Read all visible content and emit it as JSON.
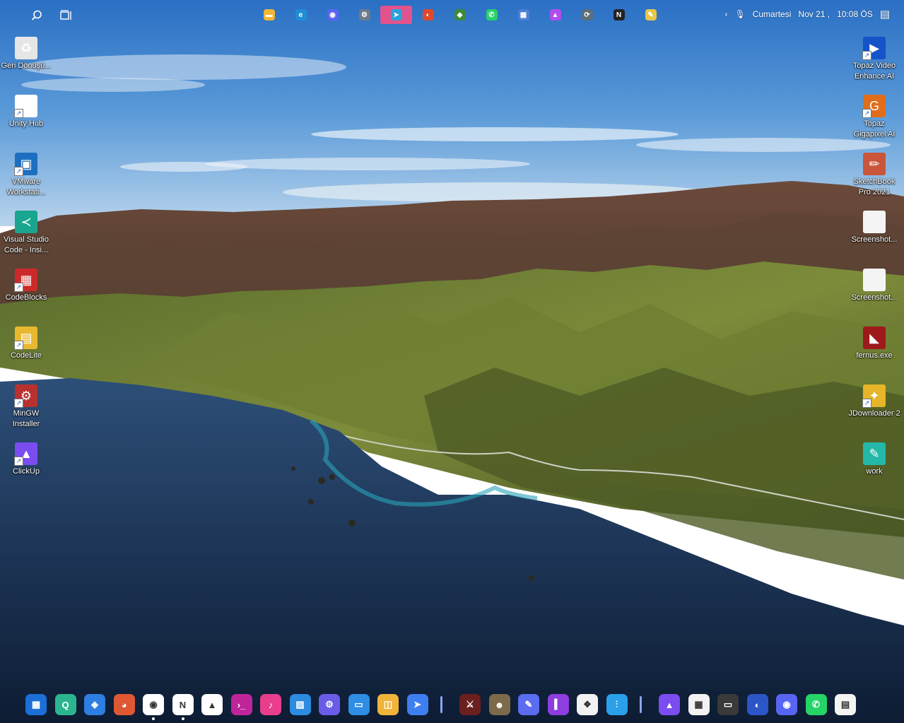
{
  "topbar": {
    "left_icons": [
      "search-icon",
      "task-view-icon"
    ],
    "apps": [
      {
        "name": "file-explorer-icon",
        "color": "#f2b632",
        "glyph": "▬",
        "active": false
      },
      {
        "name": "edge-icon",
        "color": "#1f8fd6",
        "glyph": "e",
        "active": false
      },
      {
        "name": "discord-icon",
        "color": "#5865f2",
        "glyph": "◉",
        "active": false
      },
      {
        "name": "settings-icon",
        "color": "#6b7b8c",
        "glyph": "⚙",
        "active": false
      },
      {
        "name": "telegram-icon",
        "color": "#2aa1da",
        "glyph": "➤",
        "active": true
      },
      {
        "name": "headphones-icon",
        "color": "#e0482d",
        "glyph": "◐",
        "active": false
      },
      {
        "name": "globe-icon",
        "color": "#3c8a3c",
        "glyph": "◆",
        "active": false
      },
      {
        "name": "whatsapp-icon",
        "color": "#25d366",
        "glyph": "✆",
        "active": false
      },
      {
        "name": "store-icon",
        "color": "#4e7fd8",
        "glyph": "▦",
        "active": false
      },
      {
        "name": "clickup-icon",
        "color": "#b04cf0",
        "glyph": "▲",
        "active": false
      },
      {
        "name": "sync-icon",
        "color": "#5a6e7c",
        "glyph": "⟳",
        "active": false
      },
      {
        "name": "notion-icon",
        "color": "#222222",
        "glyph": "N",
        "active": false
      },
      {
        "name": "notepad-icon",
        "color": "#e8c64a",
        "glyph": "✎",
        "active": false
      }
    ],
    "day": "Cumartesi",
    "date": "Nov 21 ,",
    "time": "10:08 ÖS"
  },
  "desktop_left": [
    {
      "name": "recycle-bin",
      "label": "Geri Dönüşü...",
      "color": "#e6e6e6",
      "glyph": "♻",
      "shortcut": false
    },
    {
      "name": "unity-hub",
      "label": "Unity Hub",
      "color": "#ffffff",
      "glyph": "◇",
      "shortcut": true
    },
    {
      "name": "vmware",
      "label": "VMware Workstati...",
      "color": "#1d6fbf",
      "glyph": "▣",
      "shortcut": true
    },
    {
      "name": "vscode",
      "label": "Visual Studio Code - Insi...",
      "color": "#1aa58e",
      "glyph": "≺",
      "shortcut": false
    },
    {
      "name": "codeblocks",
      "label": "CodeBlocks",
      "color": "#cc2a2a",
      "glyph": "▦",
      "shortcut": true
    },
    {
      "name": "codelite",
      "label": "CodeLite",
      "color": "#e8b830",
      "glyph": "▤",
      "shortcut": true
    },
    {
      "name": "mingw",
      "label": "MinGW Installer",
      "color": "#b8312f",
      "glyph": "⚙",
      "shortcut": true
    },
    {
      "name": "clickup",
      "label": "ClickUp",
      "color": "#7b4cf0",
      "glyph": "▲",
      "shortcut": true
    }
  ],
  "desktop_right": [
    {
      "name": "topaz-video",
      "label": "Topaz Video Enhance AI",
      "color": "#1553c9",
      "glyph": "▶",
      "shortcut": true
    },
    {
      "name": "topaz-gigapixel",
      "label": "Topaz Gigapixel AI",
      "color": "#e06d1c",
      "glyph": "G",
      "shortcut": true
    },
    {
      "name": "sketchbook",
      "label": "SketchBook Pro 2021",
      "color": "#c9553b",
      "glyph": "✏",
      "shortcut": false
    },
    {
      "name": "screenshot-1",
      "label": "Screenshot...",
      "color": "#f4f4f4",
      "glyph": "",
      "shortcut": false
    },
    {
      "name": "screenshot-2",
      "label": "Screenshot...",
      "color": "#f4f4f4",
      "glyph": "",
      "shortcut": false
    },
    {
      "name": "fernus",
      "label": "fernus.exe",
      "color": "#9e1a1a",
      "glyph": "◣",
      "shortcut": false
    },
    {
      "name": "jdownloader",
      "label": "JDownloader 2",
      "color": "#e6b52a",
      "glyph": "✦",
      "shortcut": true
    },
    {
      "name": "work",
      "label": "work",
      "color": "#24b8a8",
      "glyph": "✎",
      "shortcut": false
    }
  ],
  "dock": {
    "group1": [
      {
        "name": "start-icon",
        "color": "#1c6fd6",
        "glyph": "▦",
        "running": false
      },
      {
        "name": "search-app-icon",
        "color": "#2bb58f",
        "glyph": "Q",
        "running": false
      },
      {
        "name": "store-app-icon",
        "color": "#2e7de0",
        "glyph": "◈",
        "running": false
      },
      {
        "name": "duckduckgo-icon",
        "color": "#de5833",
        "glyph": "◕",
        "running": false
      },
      {
        "name": "chrome-icon",
        "color": "#ffffff",
        "glyph": "◉",
        "running": true
      },
      {
        "name": "notion-dock-icon",
        "color": "#ffffff",
        "glyph": "N",
        "running": true
      },
      {
        "name": "drive-icon",
        "color": "#ffffff",
        "glyph": "▲",
        "running": false
      },
      {
        "name": "terminal-icon",
        "color": "#c0249b",
        "glyph": "›_",
        "running": false
      },
      {
        "name": "music-icon",
        "color": "#e83e8c",
        "glyph": "♪",
        "running": false
      },
      {
        "name": "photos-icon",
        "color": "#2d8be0",
        "glyph": "▨",
        "running": false
      },
      {
        "name": "settings-dock-icon",
        "color": "#6b5ce7",
        "glyph": "⚙",
        "running": false
      },
      {
        "name": "files-icon",
        "color": "#2f8de4",
        "glyph": "▭",
        "running": false
      },
      {
        "name": "notes-icon",
        "color": "#f1b43b",
        "glyph": "◫",
        "running": false
      },
      {
        "name": "send-icon",
        "color": "#3d7ff0",
        "glyph": "➤",
        "running": false
      }
    ],
    "group2": [
      {
        "name": "game-1-icon",
        "color": "#6b1f1f",
        "glyph": "⚔",
        "running": false
      },
      {
        "name": "game-2-icon",
        "color": "#7d6a4a",
        "glyph": "☻",
        "running": false
      },
      {
        "name": "brush-icon",
        "color": "#5c6cf0",
        "glyph": "✎",
        "running": false
      },
      {
        "name": "audio-icon",
        "color": "#8d3de0",
        "glyph": "▍",
        "running": false
      },
      {
        "name": "cube-icon",
        "color": "#f2f2f2",
        "glyph": "❖",
        "running": false
      },
      {
        "name": "mixer-icon",
        "color": "#2aa0e8",
        "glyph": "⫶",
        "running": false
      }
    ],
    "group3": [
      {
        "name": "clickup-dock-icon",
        "color": "#7b4cf0",
        "glyph": "▲",
        "running": false
      },
      {
        "name": "ms-store-icon",
        "color": "#f2f2f2",
        "glyph": "▦",
        "running": false
      },
      {
        "name": "screen-capture-icon",
        "color": "#3a3a3a",
        "glyph": "▭",
        "running": false
      },
      {
        "name": "headphones-dock-icon",
        "color": "#2c55c7",
        "glyph": "◐",
        "running": false
      },
      {
        "name": "discord-dock-icon",
        "color": "#5865f2",
        "glyph": "◉",
        "running": false
      },
      {
        "name": "whatsapp-dock-icon",
        "color": "#25d366",
        "glyph": "✆",
        "running": false
      },
      {
        "name": "certificate-icon",
        "color": "#f4f4f4",
        "glyph": "▤",
        "running": false
      }
    ]
  }
}
